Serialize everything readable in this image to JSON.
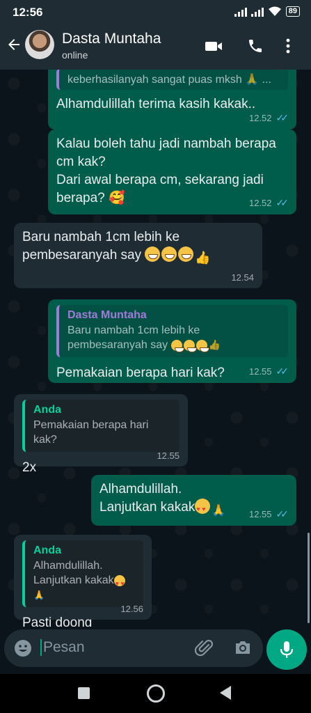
{
  "status_bar": {
    "time": "12:56",
    "battery": "89"
  },
  "header": {
    "contact_name": "Dasta Muntaha",
    "status": "online"
  },
  "messages": [
    {
      "text": "keberhasilanyah sangat puas mksh 🙏 ...",
      "partial": true
    },
    {
      "text": "Alhamdulillah terima kasih kakak..",
      "time": "12.52"
    },
    {
      "line1": "Kalau boleh tahu jadi nambah berapa",
      "line2": "cm kak?",
      "line3": "Dari awal berapa cm, sekarang jadi",
      "line4": "berapa? 🥰",
      "time": "12.52"
    },
    {
      "line1": "Baru nambah 1cm lebih ke",
      "line2": "pembesaranyah say",
      "time": "12.54"
    },
    {
      "quote_author": "Dasta Muntaha",
      "quote_line1": "Baru nambah 1cm lebih ke",
      "quote_line2": "pembesaranyah say",
      "text": "Pemakaian berapa hari kak?",
      "time": "12.55"
    },
    {
      "quote_author": "Anda",
      "quote_line1": "Pemakaian berapa hari kak?",
      "text": "2x",
      "time": "12.55"
    },
    {
      "line1": "Alhamdulillah.",
      "line2": "Lanjutkan kakak",
      "time": "12.55"
    },
    {
      "quote_author": "Anda",
      "quote_line1": "Alhamdulillah.",
      "quote_line2": "Lanjutkan kakak",
      "text": "Pasti doong",
      "time": "12.56"
    }
  ],
  "input": {
    "placeholder": "Pesan"
  },
  "icons": [
    "back-arrow-icon",
    "video-call-icon",
    "phone-icon",
    "more-options-icon",
    "emoji-icon",
    "attach-icon",
    "camera-icon",
    "mic-icon",
    "home-icon",
    "recents-icon",
    "nav-back-icon"
  ],
  "colors": {
    "outgoing": "#005c4b",
    "incoming": "#1f2c34",
    "accent": "#00a884",
    "read_ticks": "#53bdeb"
  }
}
